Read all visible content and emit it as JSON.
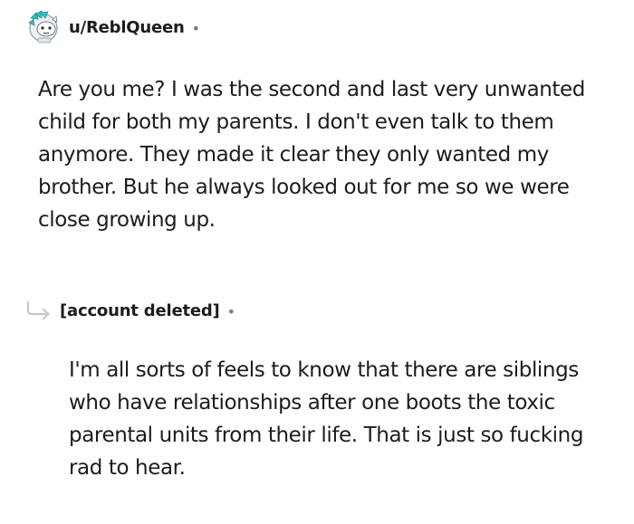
{
  "parent_comment": {
    "username": "u/ReblQueen",
    "separator": "•",
    "avatar_icon": "snoo-avatar-icon",
    "body": "Are you me? I was the second and last very unwanted child for both my parents. I don't even talk to them anymore. They made it clear they only wanted my brother. But he always looked out for me so we were close growing up."
  },
  "reply_comment": {
    "reply_icon": "reply-arrow-icon",
    "author": "[account deleted]",
    "separator": "•",
    "body": "I'm all sorts of feels to know that there are siblings who have relationships after one boots the toxic parental units from their life. That is just so fucking rad to hear."
  },
  "colors": {
    "text": "#1c1c1c",
    "meta": "#7c7c7c",
    "avatar_accent": "#2ec4c4",
    "reply_arrow": "#c8c8c8"
  }
}
